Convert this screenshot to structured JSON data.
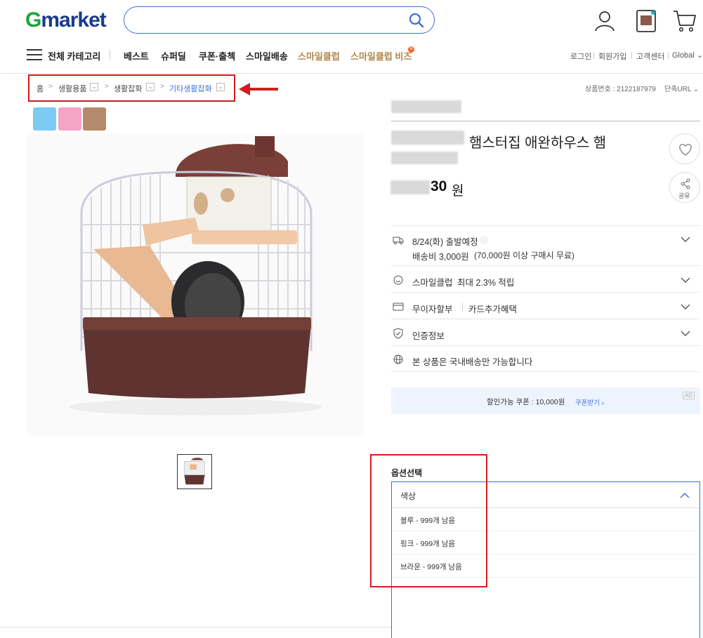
{
  "header": {
    "logo_g": "G",
    "logo_rest": "market",
    "search_placeholder": ""
  },
  "nav": {
    "all_categories": "전체 카테고리",
    "items": [
      "베스트",
      "슈퍼딜",
      "쿠폰·출첵",
      "스마일배송",
      "스마일클럽",
      "스마일클럽 비즈"
    ],
    "badge": "N",
    "util": [
      "로그인",
      "회원가입",
      "고객센터",
      "Global ⌄"
    ]
  },
  "breadcrumb": [
    "홈",
    "생활용품",
    "생활잡화",
    "기타생활잡화"
  ],
  "product": {
    "number_label": "상품번호 : 2122187979",
    "short_url": "단축URL ⌄",
    "title": "햄스터집 애완하우스 햄",
    "price_suffix": "30",
    "price_unit": "원",
    "share_label": "공유"
  },
  "delivery": {
    "date": "8/24(화) 출발예정",
    "fee": "배송비 3,000원",
    "fee_note": "(70,000원 이상 구매시 무료)"
  },
  "smileclub": {
    "label": "스마일클럽",
    "benefit": "최대 2.3% 적립"
  },
  "card": {
    "label1": "무이자할부",
    "label2": "카드추가혜택"
  },
  "cert": {
    "label": "인증정보"
  },
  "domestic": {
    "label": "본 상품은 국내배송만 가능합니다"
  },
  "coupon": {
    "text": "할인가능 쿠폰 : 10,000원",
    "link": "쿠폰받기 ›",
    "ad": "AD"
  },
  "options": {
    "section_label": "옵션선택",
    "select_label": "색상",
    "items": [
      "블루 - 999개 남음",
      "핑크 - 999개 남음",
      "브라운 - 999개 남음"
    ]
  },
  "colors": {
    "swatch_blue": "#7ccbf5",
    "swatch_pink": "#f5a4c8",
    "swatch_brown": "#b58a6a",
    "accent_blue": "#3a6fd8",
    "annotation_red": "#d21c1c"
  }
}
